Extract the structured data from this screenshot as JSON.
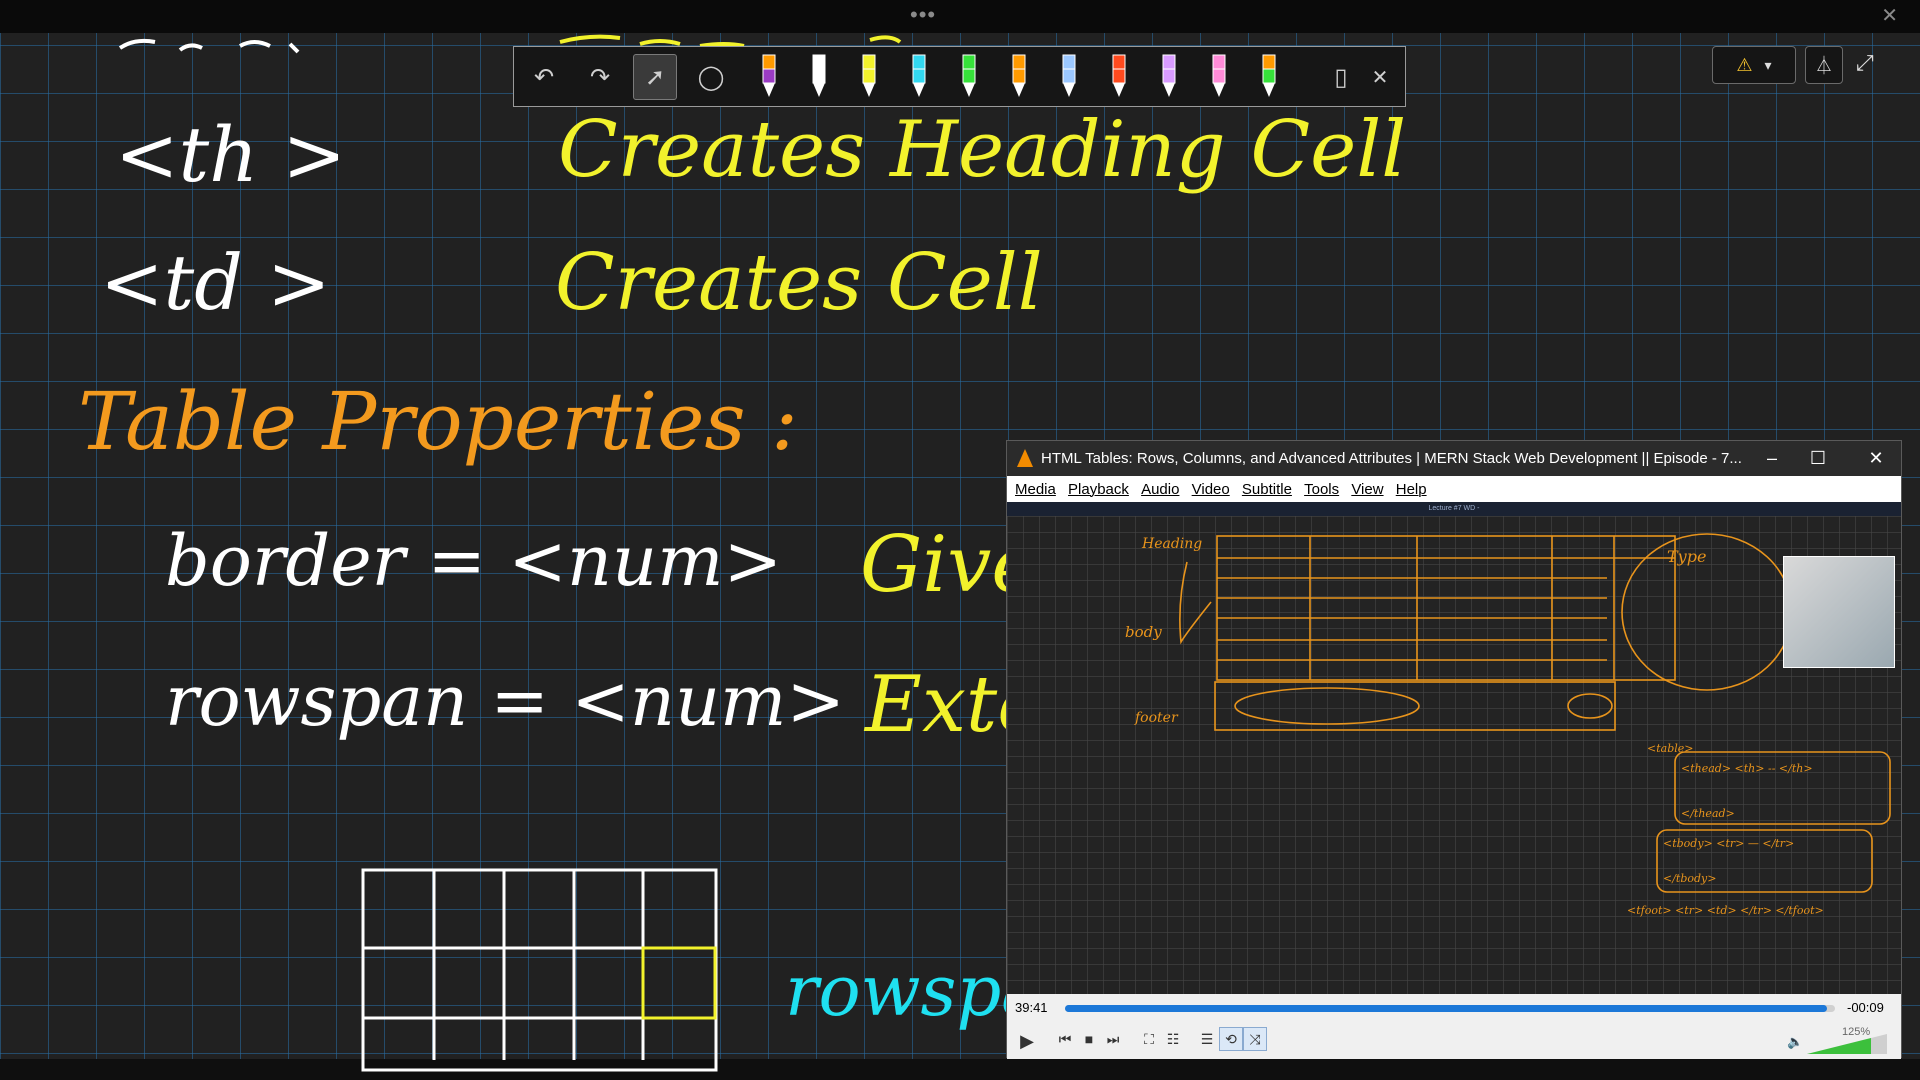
{
  "whiteboard": {
    "line_th_tag": "<th >",
    "line_th_desc": "Creates Heading Cell",
    "line_td_tag": "<td >",
    "line_td_desc": "Creates Cell",
    "section_title": "Table Properties :",
    "prop_border": "border = <num>",
    "prop_border_desc": "Give",
    "prop_rowspan": "rowspan = <num>",
    "prop_rowspan_desc": "Exten",
    "label_rowspan": "rowspan",
    "colors": {
      "white": "#ffffff",
      "yellow": "#f2f22c",
      "orange": "#f39a1e",
      "cyan": "#1fe0f0",
      "background": "#212121",
      "grid": "#286ea5"
    }
  },
  "drawing_toolbar": {
    "tools": [
      "undo-icon",
      "redo-icon",
      "select-icon",
      "lasso-icon"
    ],
    "pens": [
      {
        "cap": "#ff9a00",
        "body": "#9b3cc4"
      },
      {
        "cap": "#ffffff",
        "body": "#ffffff"
      },
      {
        "cap": "#f2f22c",
        "body": "#f2f22c"
      },
      {
        "cap": "#32d8f0",
        "body": "#32d8f0"
      },
      {
        "cap": "#36e23a",
        "body": "#36e23a"
      },
      {
        "cap": "#ff9a00",
        "body": "#ff9a00"
      },
      {
        "cap": "#9cc8ff",
        "body": "#9cc8ff"
      },
      {
        "cap": "#ff4a1e",
        "body": "#ff4a1e"
      },
      {
        "cap": "#d99cff",
        "body": "#d99cff"
      },
      {
        "cap": "#ff8cd8",
        "body": "#ff8cd8"
      },
      {
        "cap": "#ff9a00",
        "body": "#36e23a"
      }
    ],
    "eraser": "eraser-icon",
    "close": "close-icon"
  },
  "vlc": {
    "title": "HTML Tables: Rows, Columns, and Advanced Attributes | MERN Stack Web Development || Episode - 7...",
    "menu": [
      "Media",
      "Playback",
      "Audio",
      "Video",
      "Subtitle",
      "Tools",
      "View",
      "Help"
    ],
    "video_header": "Lecture #7 WD -",
    "video_labels": {
      "heading": "Heading",
      "body": "body",
      "footer": "footer",
      "type": "Type",
      "table": "<table>",
      "thead": "<thead> <th> -- </th>",
      "thead_close": "</thead>",
      "tbody": "<tbody> <tr> — </tr>",
      "tbody_close": "</tbody>",
      "tfoot": "<tfoot> <tr> <td> </tr> </tfoot>"
    },
    "elapsed": "39:41",
    "remaining": "-00:09",
    "progress": 0.99,
    "volume": "125%"
  }
}
